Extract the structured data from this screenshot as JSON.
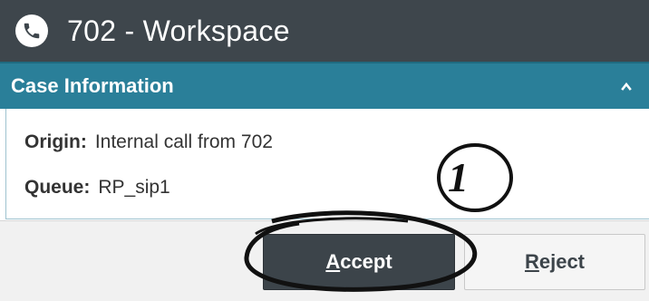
{
  "window": {
    "title": "702 - Workspace",
    "icon": "phone-icon"
  },
  "panel": {
    "title": "Case Information",
    "collapse_icon": "chevron-up-icon",
    "fields": [
      {
        "label": "Origin:",
        "value": "Internal call from 702"
      },
      {
        "label": "Queue:",
        "value": "RP_sip1"
      }
    ]
  },
  "actions": {
    "accept_label_first": "A",
    "accept_label_rest": "ccept",
    "reject_label_first": "R",
    "reject_label_rest": "eject"
  },
  "annotation": {
    "step_number": "1"
  },
  "colors": {
    "title_bar": "#3e464c",
    "panel_header": "#2a7f99",
    "accept_bg": "#3c444a",
    "reject_bg": "#f5f5f5"
  }
}
